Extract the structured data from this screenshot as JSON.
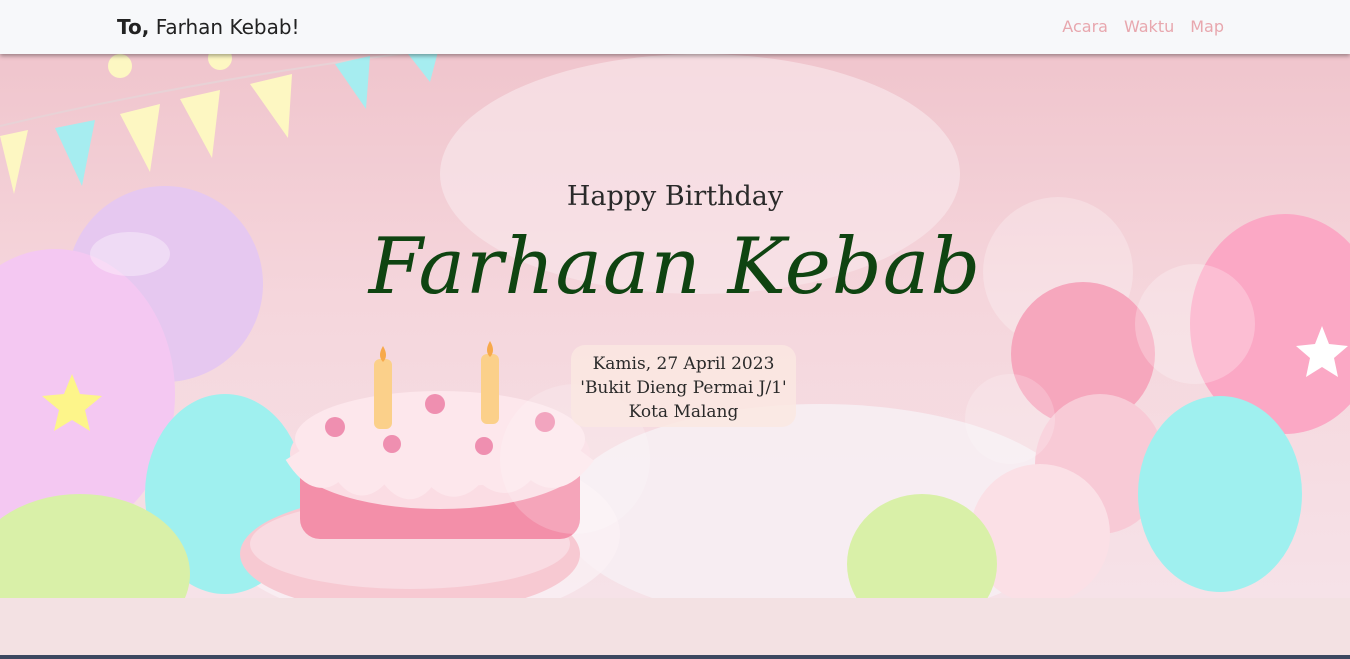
{
  "navbar": {
    "brand_strong": "To,",
    "brand_name": "Farhan Kebab!",
    "links": [
      "Acara",
      "Waktu",
      "Map"
    ]
  },
  "hero": {
    "subtitle": "Happy Birthday",
    "name": "Farhaan Kebab",
    "date": "Kamis, 27 April 2023",
    "address": "'Bukit Dieng Permai J/1'",
    "city": "Kota Malang"
  },
  "icons": [
    "birthday-cake-icon",
    "balloon-icon",
    "bunting-flag-icon",
    "star-icon"
  ],
  "colors": {
    "nav_link": "#e8a7ae",
    "name": "#0f4411",
    "hero_bg": "#f0c5cd"
  }
}
